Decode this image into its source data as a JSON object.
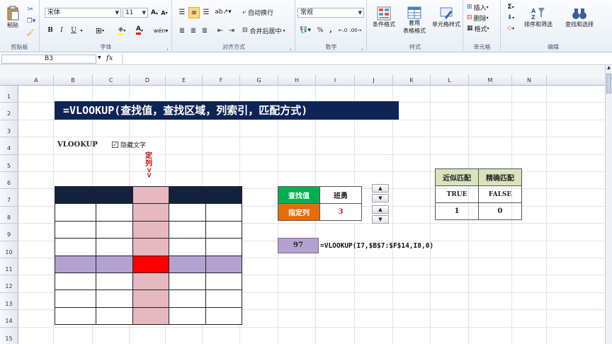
{
  "ribbon": {
    "clipboard": {
      "paste": "粘贴",
      "label": "剪贴板"
    },
    "font": {
      "name": "宋体",
      "size": "11",
      "bold": "B",
      "italic": "I",
      "underline": "U",
      "label": "字体"
    },
    "alignment": {
      "wrap": "自动换行",
      "merge": "合并后居中",
      "label": "对齐方式"
    },
    "number": {
      "format": "常规",
      "percent": "%",
      "comma": ",",
      "label": "数字"
    },
    "styles": {
      "conditional": "条件格式",
      "table_line1": "套用",
      "table_line2": "表格格式",
      "cell_styles": "单元格样式",
      "label": "样式"
    },
    "cells": {
      "insert": "插入",
      "delete": "删除",
      "format": "格式",
      "label": "单元格"
    },
    "editing": {
      "sigma": "Σ",
      "sort": "排序和筛选",
      "find": "查找和选择",
      "label": "编辑"
    }
  },
  "formula_bar": {
    "name_box": "B3",
    "fx": "fx",
    "content": ""
  },
  "columns": [
    "A",
    "B",
    "C",
    "D",
    "E",
    "F",
    "G",
    "H",
    "I",
    "J",
    "K",
    "L",
    "M",
    "N"
  ],
  "rows": [
    "1",
    "2",
    "3",
    "4",
    "5",
    "6",
    "7",
    "8",
    "9",
    "10",
    "11",
    "12",
    "13",
    "14",
    "15"
  ],
  "sheet": {
    "title": "=VLOOKUP(查找值，查找区域，列索引，匹配方式)",
    "vlookup_label": "VLOOKUP",
    "checkbox_label": "隐藏文字",
    "vertical_text": "定列>>",
    "lookup": {
      "key_label": "查找值",
      "key_value": "班勇",
      "col_label": "指定列",
      "col_value": "3"
    },
    "result": "97",
    "formula": "=VLOOKUP(I7,$B$7:$F$14,I8,0)",
    "match_table": {
      "headers": [
        "近似匹配",
        "精确匹配"
      ],
      "row1": [
        "TRUE",
        "FALSE"
      ],
      "row2": [
        "1",
        "0"
      ]
    }
  },
  "colors": {
    "title_bg": "#0f2456",
    "header_row": "#14213d",
    "highlight_col": "#e6b8c0",
    "highlight_row": "#b3a2cf",
    "intersection": "#ff0000",
    "key_green": "#00b050",
    "col_orange": "#e46c0a",
    "match_header_bg": "#d8e4bc"
  }
}
